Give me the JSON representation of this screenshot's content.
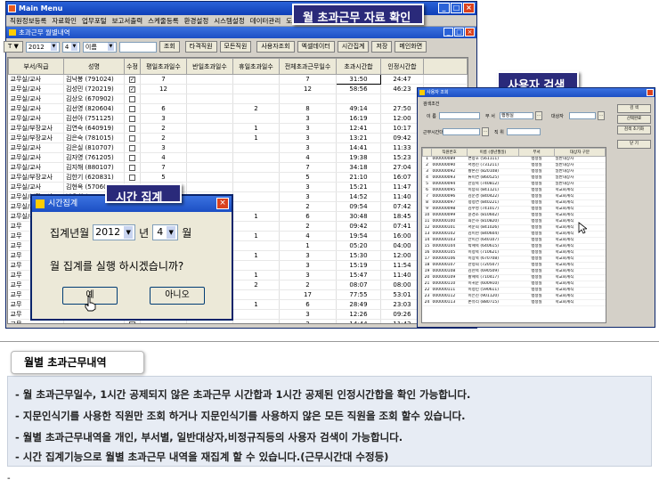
{
  "main_window": {
    "title": "Main Menu",
    "menu": [
      "직원정보등록",
      "자료확인",
      "업무포털",
      "보고서출력",
      "스케줄등록",
      "환경설정",
      "시스템설정",
      "데이터관리",
      "도움말"
    ],
    "sub_title": "초과근무 월별내역",
    "toolbar": {
      "t_button": "T ▼",
      "year": "2012",
      "month": "4",
      "name_field": "이름",
      "search": "조회",
      "other_search": "타격직원",
      "all_search": "모든직원",
      "user_search": "사용자조회",
      "excel": "엑셀데이터",
      "time_sum": "시간집계",
      "save": "저장",
      "previous": "메인화면"
    },
    "columns": [
      "부서/직급",
      "성명",
      "수정",
      "평일초과일수",
      "반일초과일수",
      "휴일초과일수",
      "전체초과근무일수",
      "초과시간합",
      "인정시간합"
    ],
    "rows": [
      [
        "교무실/교사",
        "김낙봉 (791024)",
        "✓",
        "7",
        "",
        "",
        "7",
        "31:50",
        "24:47"
      ],
      [
        "교무실/교사",
        "김성민 (720219)",
        "✓",
        "12",
        "",
        "",
        "12",
        "58:56",
        "46:23"
      ],
      [
        "교무실/교사",
        "김상오 (670902)",
        "",
        "",
        "",
        "",
        "",
        "",
        ""
      ],
      [
        "교무실/교사",
        "김선영 (820604)",
        "",
        "6",
        "",
        "2",
        "8",
        "49:14",
        "27:50"
      ],
      [
        "교무실/교사",
        "김선아 (751125)",
        "",
        "3",
        "",
        "",
        "3",
        "16:19",
        "12:00"
      ],
      [
        "교무실/부장교사",
        "김연숙 (640919)",
        "",
        "2",
        "",
        "1",
        "3",
        "12:41",
        "10:17"
      ],
      [
        "교무실/부장교사",
        "김은숙 (781015)",
        "",
        "2",
        "",
        "1",
        "3",
        "13:21",
        "09:42"
      ],
      [
        "교무실/교사",
        "김은실 (810707)",
        "",
        "3",
        "",
        "",
        "3",
        "14:41",
        "11:33"
      ],
      [
        "교무실/교사",
        "김자영 (761205)",
        "",
        "4",
        "",
        "",
        "4",
        "19:38",
        "15:23"
      ],
      [
        "교무실/교사",
        "김지해 (880107)",
        "",
        "7",
        "",
        "",
        "7",
        "34:18",
        "27:04"
      ],
      [
        "교무실/부장교사",
        "김한기 (620831)",
        "",
        "5",
        "",
        "",
        "5",
        "21:10",
        "16:07"
      ],
      [
        "교무실/교사",
        "김현옥 (570607)",
        "",
        "3",
        "",
        "",
        "3",
        "15:21",
        "11:47"
      ],
      [
        "교무실/부장교사",
        "남은희 (766042)",
        "",
        "3",
        "",
        "",
        "3",
        "14:52",
        "11:40"
      ],
      [
        "교무실/교사",
        "민주영 (86",
        "",
        "",
        "",
        "",
        "2",
        "09:54",
        "07:42"
      ],
      [
        "교무실/부장교사",
        "박경희 (64",
        "",
        "",
        "",
        "1",
        "6",
        "30:48",
        "18:45"
      ],
      [
        "교무",
        "",
        "",
        "",
        "",
        "",
        "2",
        "09:42",
        "07:41"
      ],
      [
        "교무",
        "",
        "",
        "",
        "",
        "1",
        "4",
        "19:54",
        "16:00"
      ],
      [
        "교무",
        "",
        "",
        "",
        "",
        "",
        "1",
        "05:20",
        "04:00"
      ],
      [
        "교무",
        "",
        "",
        "",
        "",
        "1",
        "3",
        "15:30",
        "12:00"
      ],
      [
        "교무",
        "",
        "",
        "",
        "",
        "",
        "3",
        "15:19",
        "11:54"
      ],
      [
        "교무",
        "",
        "",
        "",
        "",
        "1",
        "3",
        "15:47",
        "11:40"
      ],
      [
        "교무",
        "",
        "",
        "",
        "",
        "2",
        "2",
        "08:07",
        "08:00"
      ],
      [
        "교무",
        "",
        "",
        "",
        "",
        "",
        "17",
        "77:55",
        "53:01"
      ],
      [
        "교무",
        "",
        "",
        "",
        "",
        "1",
        "6",
        "28:49",
        "23:03"
      ],
      [
        "교무",
        "",
        "",
        "",
        "",
        "",
        "3",
        "12:26",
        "09:26"
      ],
      [
        "교무",
        "",
        "",
        "",
        "",
        "",
        "3",
        "14:44",
        "11:42"
      ],
      [
        "교무",
        "",
        "",
        "",
        "",
        "1",
        "8",
        "32:20",
        "23:44"
      ],
      [
        "교무",
        "",
        "",
        "",
        "",
        "",
        "3",
        "14:38",
        "11:29"
      ],
      [
        "교무",
        "",
        "",
        "",
        "",
        "",
        "2",
        "10:07",
        "08:00"
      ],
      [
        "교무",
        "",
        "",
        "",
        "",
        "",
        "6",
        "30:25",
        "23:10"
      ]
    ]
  },
  "callouts": {
    "main": "월 초과근무 자료 확인",
    "user": "사용자 검색",
    "time": "시간 집계"
  },
  "time_dialog": {
    "title": "시간집계",
    "label_prefix": "집계년월",
    "year": "2012",
    "year_suffix": "년",
    "month": "4",
    "month_suffix": "월",
    "message": "월 집계를 실행 하시겠습니까?",
    "yes": "예",
    "no": "아니오"
  },
  "user_dialog": {
    "title": "사용자 조회",
    "group_label": "검색조건",
    "name_label": "이 름",
    "dept_label": "부 서",
    "dept_value": "행정실",
    "target_label": "대상자",
    "job_label": "근무시간대",
    "rank_label": "직 위",
    "search_btn": "검 색",
    "select_btn": "선택완료",
    "clear_btn": "검색 초기화",
    "close_btn": "닫 기",
    "columns": [
      "",
      "직원번호",
      "이름 (생년월일)",
      "부서",
      "대상자 구분"
    ],
    "rows": [
      [
        "1",
        "000000089",
        "변창호 (561111)",
        "행정실",
        "일반대상자"
      ],
      [
        "2",
        "000000090",
        "서성진 (731211)",
        "행정실",
        "일반대상자"
      ],
      [
        "3",
        "000000092",
        "황본진 (820108)",
        "행정실",
        "일반대상자"
      ],
      [
        "4",
        "000000093",
        "류미연 (860525)",
        "행정실",
        "일반대상자"
      ],
      [
        "5",
        "000000094",
        "한길숙 (740812)",
        "행정실",
        "일반대상자"
      ],
      [
        "6",
        "000000095",
        "이승희 (841121)",
        "행정실",
        "학교회계직"
      ],
      [
        "7",
        "000000096",
        "김순경 (840422)",
        "행정실",
        "학교회계직"
      ],
      [
        "8",
        "000000097",
        "정정연 (840221)",
        "행정실",
        "학교회계직"
      ],
      [
        "9",
        "000000098",
        "김수영 (741017)",
        "행정실",
        "학교회계직"
      ],
      [
        "10",
        "000000099",
        "윤경조 (810602)",
        "행정실",
        "학교회계직"
      ],
      [
        "11",
        "000000100",
        "최은하 (810820)",
        "행정실",
        "학교회계직"
      ],
      [
        "12",
        "000000101",
        "서문희 (841026)",
        "행정실",
        "학교회계직"
      ],
      [
        "13",
        "000000102",
        "김미현 (840604)",
        "행정실",
        "학교회계직"
      ],
      [
        "14",
        "000000103",
        "안미선 (640107)",
        "행정실",
        "학교회계직"
      ],
      [
        "15",
        "000000104",
        "박혜숙 (640615)",
        "행정실",
        "학교회계직"
      ],
      [
        "16",
        "000000105",
        "이정숙 (710621)",
        "행정실",
        "학교회계직"
      ],
      [
        "17",
        "000000106",
        "이상숙 (670708)",
        "행정실",
        "학교회계직"
      ],
      [
        "18",
        "000000107",
        "한정희 (720507)",
        "행정실",
        "학교회계직"
      ],
      [
        "19",
        "000000108",
        "김현숙 (690509)",
        "행정실",
        "학교회계직"
      ],
      [
        "20",
        "000000109",
        "황혜숙 (710417)",
        "행정실",
        "학교회계직"
      ],
      [
        "21",
        "000000110",
        "이귀순 (600910)",
        "행정실",
        "학교회계직"
      ],
      [
        "22",
        "000000111",
        "이정민 (590611)",
        "행정실",
        "학교회계직"
      ],
      [
        "23",
        "000000112",
        "이은진 (901120)",
        "행정실",
        "학교회계직"
      ],
      [
        "24",
        "000000113",
        "손유리 (880715)",
        "행정실",
        "학교회계직"
      ]
    ]
  },
  "description": {
    "heading": "월별 초과근무내역",
    "lines": [
      "- 월 초과근무일수, 1시간 공제되지 않은 초과근무 시간합과 1시간 공제된 인정시간합을 확인 가능합니다.",
      "- 지문인식기를 사용한 직원만 조회 하거나 지문인식기를 사용하지 않은 모든 직원을 조회 할수 있습니다.",
      "- 월별 초과근무내역을 개인, 부서별, 일반대상자,비정규직등의 사용자 검색이 가능합니다.",
      "- 시간 집계기능으로 월별 초과근무 내역을 재집계 할 수 있습니다.(근무시간대 수정등)"
    ],
    "dash": "-"
  }
}
